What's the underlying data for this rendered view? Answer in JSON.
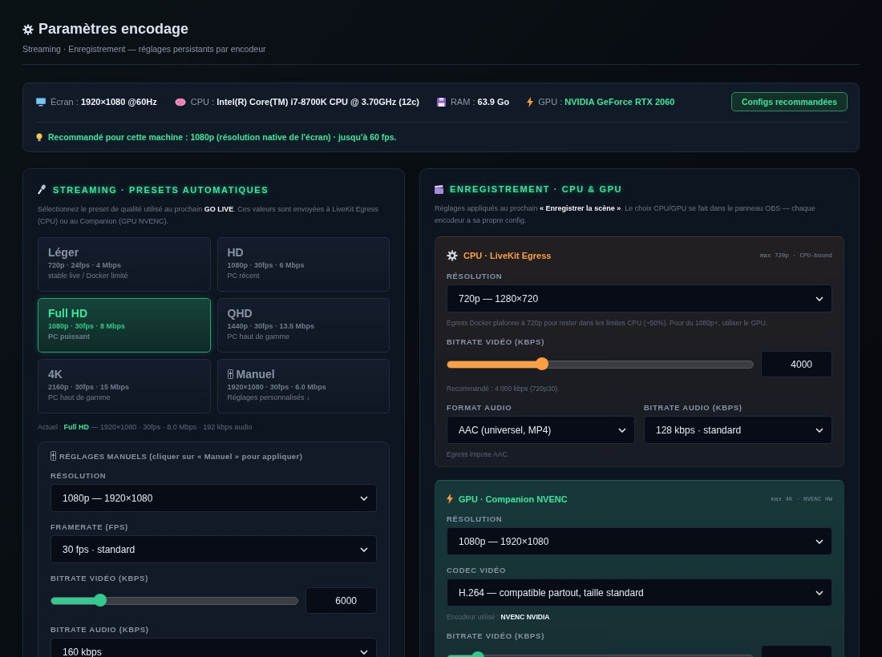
{
  "header": {
    "title": "Paramètres encodage",
    "subtitle": "Streaming · Enregistrement — réglages persistants par encodeur"
  },
  "system": {
    "items": [
      {
        "kind": "screen",
        "label": "Écran :",
        "value": "1920×1080 @60Hz",
        "accent": false
      },
      {
        "kind": "cpu",
        "label": "CPU :",
        "value": "Intel(R) Core(TM) i7-8700K CPU @ 3.70GHz (12c)",
        "accent": false
      },
      {
        "kind": "ram",
        "label": "RAM :",
        "value": "63.9 Go",
        "accent": false
      },
      {
        "kind": "gpu",
        "label": "GPU :",
        "value": "NVIDIA GeForce RTX 2060",
        "accent": true
      }
    ],
    "button": "Configs recommandées",
    "recommendation": "Recommandé pour cette machine : 1080p (résolution native de l'écran) · jusqu'à 60 fps."
  },
  "streaming": {
    "title": "STREAMING · PRESETS AUTOMATIQUES",
    "description": "Sélectionnez le preset de qualité utilisé au prochain **GO LIVE**. Ces valeurs sont envoyées à LiveKit Egress (CPU) ou au Companion (GPU NVENC).",
    "presets": [
      {
        "name": "Léger",
        "specs": "720p · 24fps · 4 Mbps",
        "note": "stable live / Docker limité",
        "selected": false,
        "manual": false
      },
      {
        "name": "HD",
        "specs": "1080p · 30fps · 6 Mbps",
        "note": "PC récent",
        "selected": false,
        "manual": false
      },
      {
        "name": "Full HD",
        "specs": "1080p · 30fps · 8 Mbps",
        "note": "PC puissant",
        "selected": true,
        "manual": false
      },
      {
        "name": "QHD",
        "specs": "1440p · 30fps · 13.5 Mbps",
        "note": "PC haut de gamme",
        "selected": false,
        "manual": false
      },
      {
        "name": "4K",
        "specs": "2160p · 30fps · 15 Mbps",
        "note": "PC haut de gamme",
        "selected": false,
        "manual": false
      },
      {
        "name": "Manuel",
        "specs": "1920×1080 · 30fps · 6.0 Mbps",
        "note": "Réglages personnalisés ↓",
        "selected": false,
        "manual": true
      }
    ],
    "current": "Actuel : **Full HD** — 1920×1080 · 30fps · 8.0 Mbps · 192 kbps audio",
    "manual": {
      "title": "RÉGLAGES MANUELS (cliquer sur « Manuel » pour appliquer)",
      "rows": [
        {
          "kind": "select",
          "label": "RÉSOLUTION",
          "value": "1080p — 1920×1080"
        },
        {
          "kind": "select",
          "label": "FRAMERATE (FPS)",
          "value": "30 fps · standard"
        },
        {
          "kind": "slider",
          "label": "BITRATE VIDÉO (KBPS)",
          "level": 0.2,
          "value": "6000"
        },
        {
          "kind": "select",
          "label": "BITRATE AUDIO (KBPS)",
          "value": "160 kbps"
        }
      ]
    }
  },
  "recording": {
    "title": "ENREGISTREMENT · CPU & GPU",
    "description": "Réglages appliqués au prochain **« Enregistrer la scène »**. Le choix CPU/GPU se fait dans le panneau OBS — chaque encodeur a sa propre config.",
    "encoders": [
      {
        "kind": "cpu",
        "title": "CPU · LiveKit Egress",
        "badge": "max 720p · CPU-bound",
        "rows": [
          {
            "kind": "select",
            "label": "RÉSOLUTION",
            "value": "720p — 1280×720"
          },
          {
            "kind": "note",
            "text": "Egress Docker plafonne à 720p pour rester dans les limites CPU (~50%). Pour du 1080p+, utiliser le GPU."
          },
          {
            "kind": "slider",
            "label": "BITRATE VIDÉO (KBPS)",
            "level": 0.31,
            "value": "4000"
          },
          {
            "kind": "note",
            "text": "Recommandé : 4 000 kbps (720p30)."
          },
          {
            "kind": "pair",
            "items": [
              {
                "label": "FORMAT AUDIO",
                "value": "AAC (universel, MP4)"
              },
              {
                "label": "BITRATE AUDIO (KBPS)",
                "value": "128 kbps · standard"
              }
            ]
          },
          {
            "kind": "note",
            "text": "Egress impose AAC."
          }
        ]
      },
      {
        "kind": "gpu",
        "title": "GPU · Companion NVENC",
        "badge": "max 4K · NVENC HW",
        "rows": [
          {
            "kind": "select",
            "label": "RÉSOLUTION",
            "value": "1080p — 1920×1080"
          },
          {
            "kind": "select",
            "label": "CODEC VIDÉO",
            "value": "H.264 — compatible partout, taille standard"
          },
          {
            "kind": "note",
            "text": "Encodeur utilisé : **NVENC NVIDIA**"
          },
          {
            "kind": "slider",
            "label": "BITRATE VIDÉO (KBPS)",
            "level": 0.1
          }
        ]
      }
    ]
  }
}
